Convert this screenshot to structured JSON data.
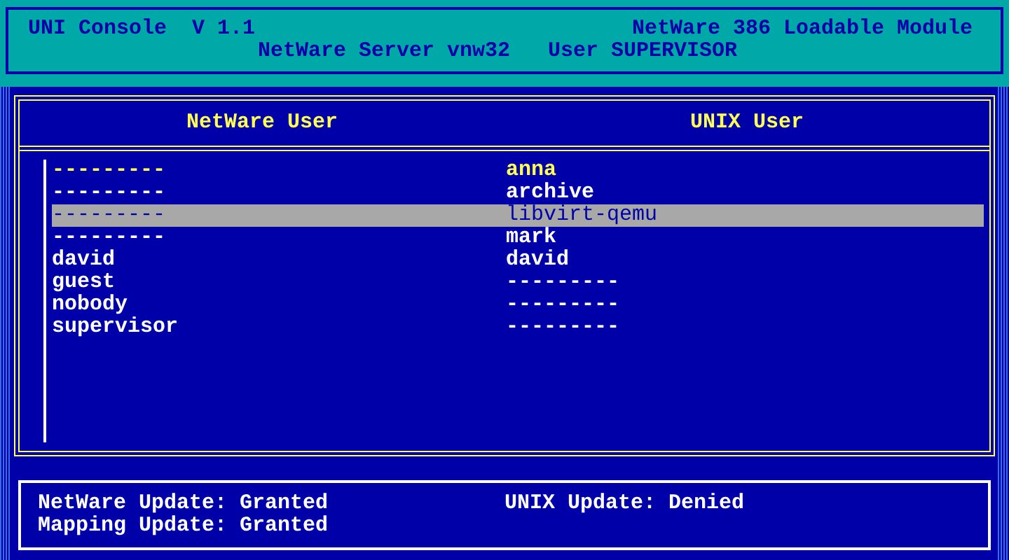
{
  "header": {
    "title": "UNI Console  V 1.1",
    "module": "NetWare 386 Loadable Module",
    "server": "NetWare Server vnw32   User SUPERVISOR"
  },
  "table": {
    "columns": [
      "NetWare User",
      "UNIX User"
    ],
    "rows": [
      {
        "netware": "---------",
        "unix": "anna",
        "current": true,
        "selected": false
      },
      {
        "netware": "---------",
        "unix": "archive",
        "current": false,
        "selected": false
      },
      {
        "netware": "---------",
        "unix": "libvirt-qemu",
        "current": false,
        "selected": true
      },
      {
        "netware": "---------",
        "unix": "mark",
        "current": false,
        "selected": false
      },
      {
        "netware": "david",
        "unix": "david",
        "current": false,
        "selected": false
      },
      {
        "netware": "guest",
        "unix": "---------",
        "current": false,
        "selected": false
      },
      {
        "netware": "nobody",
        "unix": "---------",
        "current": false,
        "selected": false
      },
      {
        "netware": "supervisor",
        "unix": "---------",
        "current": false,
        "selected": false
      }
    ]
  },
  "status": {
    "left": [
      "NetWare Update: Granted",
      "Mapping Update: Granted"
    ],
    "right": [
      "UNIX Update: Denied"
    ]
  }
}
